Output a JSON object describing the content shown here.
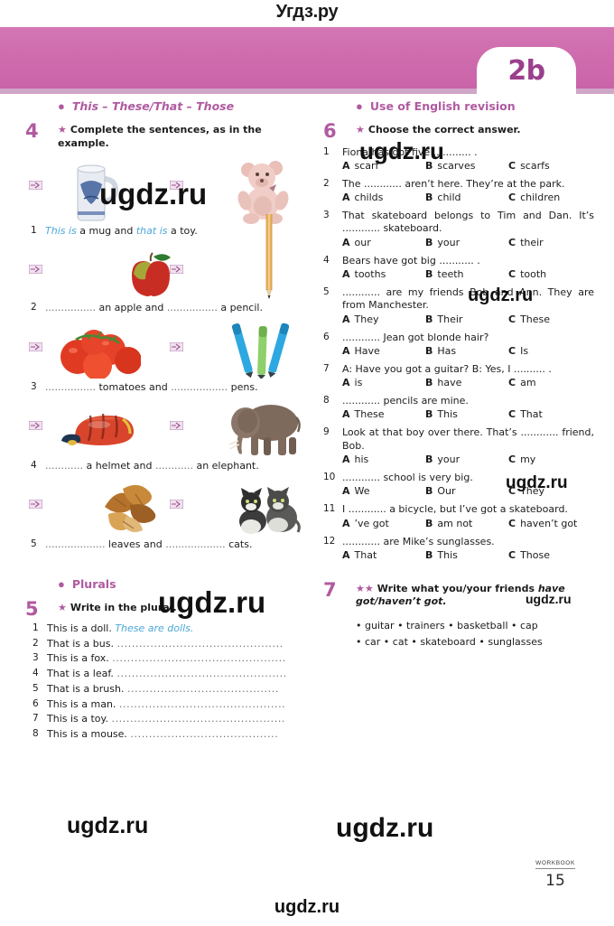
{
  "site": {
    "watermark_top": "Угдз.ру",
    "watermark": "ugdz.ru"
  },
  "header": {
    "unit_badge": "2b",
    "band_color": "#cf6cae",
    "accent_color": "#b05aa0"
  },
  "left_column": {
    "topic_1": "This – These/That – Those",
    "exercise_4": {
      "number": "4",
      "star": "★",
      "instruction": "Complete the sentences, as in the example.",
      "items": [
        {
          "n": "1",
          "pre_answer": "This is",
          "text_a": " a mug and ",
          "mid_answer": "that is",
          "text_b": " a toy.",
          "image_left": "mug",
          "image_right": "teddy-bear"
        },
        {
          "n": "2",
          "dots_a": "................",
          "text_a": " an apple and ",
          "dots_b": "................",
          "text_b": " a pencil.",
          "image_left": "apple",
          "image_right": "pencil"
        },
        {
          "n": "3",
          "dots_a": "................",
          "text_a": " tomatoes and ",
          "dots_b": "..................",
          "text_b": " pens.",
          "image_left": "tomatoes",
          "image_right": "pens"
        },
        {
          "n": "4",
          "dots_a": "............",
          "text_a": " a helmet and ",
          "dots_b": "............",
          "text_b": " an elephant.",
          "image_left": "helmet",
          "image_right": "elephant"
        },
        {
          "n": "5",
          "dots_a": "...................",
          "text_a": " leaves and ",
          "dots_b": "...................",
          "text_b": " cats.",
          "image_left": "autumn-leaves",
          "image_right": "kittens"
        }
      ]
    },
    "topic_2": "Plurals",
    "exercise_5": {
      "number": "5",
      "star": "★",
      "instruction": "Write in the plural.",
      "items": [
        {
          "n": "1",
          "prompt": "This is a doll.",
          "answer": "These are dolls.",
          "dots": ""
        },
        {
          "n": "2",
          "prompt": "That is a bus.",
          "answer": "",
          "dots": "............................................."
        },
        {
          "n": "3",
          "prompt": "This is a fox.",
          "answer": "",
          "dots": "..............................................."
        },
        {
          "n": "4",
          "prompt": "That is a leaf.",
          "answer": "",
          "dots": ".............................................."
        },
        {
          "n": "5",
          "prompt": "That is a brush.",
          "answer": "",
          "dots": "........................................."
        },
        {
          "n": "6",
          "prompt": "This is a man.",
          "answer": "",
          "dots": "............................................."
        },
        {
          "n": "7",
          "prompt": "This is a toy.",
          "answer": "",
          "dots": "..............................................."
        },
        {
          "n": "8",
          "prompt": "This is a mouse.",
          "answer": "",
          "dots": "........................................"
        }
      ]
    }
  },
  "right_column": {
    "topic_1": "Use of English revision",
    "exercise_6": {
      "number": "6",
      "star": "★",
      "instruction": "Choose the correct answer.",
      "items": [
        {
          "n": "1",
          "question": "Fiona has got five ............ .",
          "options": [
            {
              "letter": "A",
              "text": "scarf"
            },
            {
              "letter": "B",
              "text": "scarves"
            },
            {
              "letter": "C",
              "text": "scarfs"
            }
          ]
        },
        {
          "n": "2",
          "question": "The ............ aren’t here. They’re at the park.",
          "options": [
            {
              "letter": "A",
              "text": "childs"
            },
            {
              "letter": "B",
              "text": "child"
            },
            {
              "letter": "C",
              "text": "children"
            }
          ]
        },
        {
          "n": "3",
          "question": "That skateboard belongs to Tim and Dan. It’s ............ skateboard.",
          "options": [
            {
              "letter": "A",
              "text": "our"
            },
            {
              "letter": "B",
              "text": "your"
            },
            {
              "letter": "C",
              "text": "their"
            }
          ]
        },
        {
          "n": "4",
          "question": "Bears have got big ........... .",
          "options": [
            {
              "letter": "A",
              "text": "tooths"
            },
            {
              "letter": "B",
              "text": "teeth"
            },
            {
              "letter": "C",
              "text": "tooth"
            }
          ]
        },
        {
          "n": "5",
          "question": "............ are my friends Bob and Ann. They are from Manchester.",
          "options": [
            {
              "letter": "A",
              "text": "They"
            },
            {
              "letter": "B",
              "text": "Their"
            },
            {
              "letter": "C",
              "text": "These"
            }
          ]
        },
        {
          "n": "6",
          "question": "............ Jean got blonde hair?",
          "options": [
            {
              "letter": "A",
              "text": "Have"
            },
            {
              "letter": "B",
              "text": "Has"
            },
            {
              "letter": "C",
              "text": "Is"
            }
          ]
        },
        {
          "n": "7",
          "question": "A: Have you got a guitar?   B: Yes, I .......... .",
          "options": [
            {
              "letter": "A",
              "text": "is"
            },
            {
              "letter": "B",
              "text": "have"
            },
            {
              "letter": "C",
              "text": "am"
            }
          ]
        },
        {
          "n": "8",
          "question": "............ pencils are mine.",
          "options": [
            {
              "letter": "A",
              "text": "These"
            },
            {
              "letter": "B",
              "text": "This"
            },
            {
              "letter": "C",
              "text": "That"
            }
          ]
        },
        {
          "n": "9",
          "question": "Look at that boy over there. That’s ............ friend, Bob.",
          "options": [
            {
              "letter": "A",
              "text": "his"
            },
            {
              "letter": "B",
              "text": "your"
            },
            {
              "letter": "C",
              "text": "my"
            }
          ]
        },
        {
          "n": "10",
          "question": "............ school is very big.",
          "options": [
            {
              "letter": "A",
              "text": "We"
            },
            {
              "letter": "B",
              "text": "Our"
            },
            {
              "letter": "C",
              "text": "They"
            }
          ]
        },
        {
          "n": "11",
          "question": "I ............ a bicycle, but I’ve got a skateboard.",
          "options": [
            {
              "letter": "A",
              "text": "’ve got"
            },
            {
              "letter": "B",
              "text": "am not"
            },
            {
              "letter": "C",
              "text": "haven’t got"
            }
          ]
        },
        {
          "n": "12",
          "question": "............ are Mike’s sunglasses.",
          "options": [
            {
              "letter": "A",
              "text": "That"
            },
            {
              "letter": "B",
              "text": "This"
            },
            {
              "letter": "C",
              "text": "Those"
            }
          ]
        }
      ]
    },
    "exercise_7": {
      "number": "7",
      "star": "★★",
      "instruction_bold": "Write what you/your friends ",
      "instruction_italic": "have got/haven’t got.",
      "wordbank_line_1": "• guitar  • trainers  • basketball  • cap",
      "wordbank_line_2": "• car  • cat  • skateboard  • sunglasses"
    }
  },
  "footer": {
    "label": "WORKBOOK",
    "page_number": "15"
  }
}
